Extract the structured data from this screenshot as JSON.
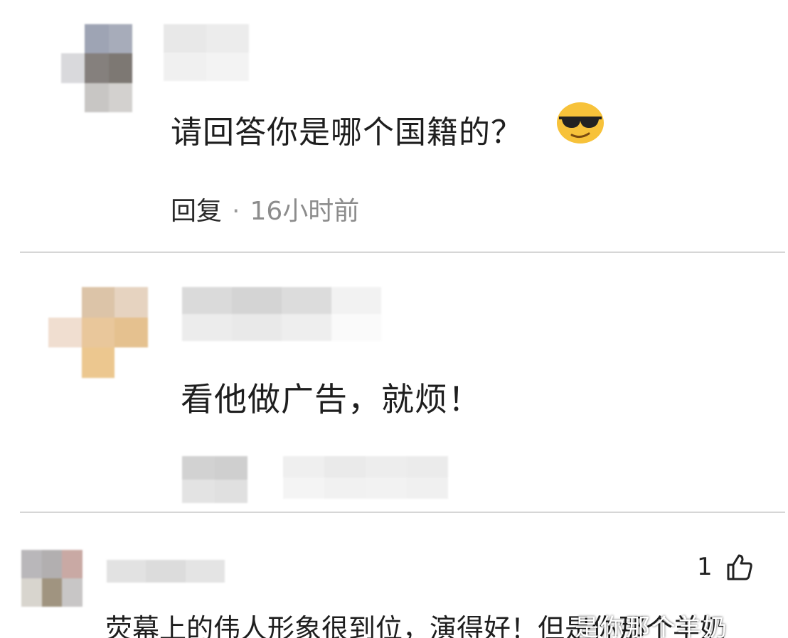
{
  "comments": [
    {
      "text": "请回答你是哪个国籍的？",
      "emoji": "sunglasses-face-emoji",
      "reply_label": "回复",
      "separator": "·",
      "time": "16小时前"
    },
    {
      "text": "看他做广告，就烦！"
    },
    {
      "text": "荧幕上的伟人形象很到位，演得好！但是你那个羊奶",
      "like_count": "1",
      "like_icon": "thumbs-up-icon"
    }
  ],
  "watermark": "是你那个羊奶",
  "colors": {
    "divider": "#d6d6d6",
    "time": "#8c8c8c",
    "emoji_yellow": "#f7c23a"
  }
}
